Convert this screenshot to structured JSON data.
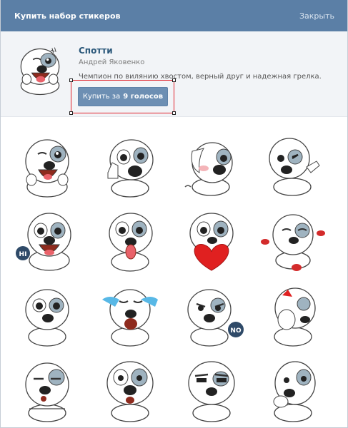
{
  "dialog": {
    "title": "Купить набор стикеров",
    "close_label": "Закрыть"
  },
  "pack": {
    "name": "Спотти",
    "author": "Андрей Яковенко",
    "description": "Чемпион по вилянию хвостом, верный друг и надежная грелка.",
    "buy_label": "Купить за",
    "buy_price": "9 голосов"
  },
  "stickers": [
    {
      "label": "HI"
    },
    {
      "label": "NO"
    }
  ]
}
